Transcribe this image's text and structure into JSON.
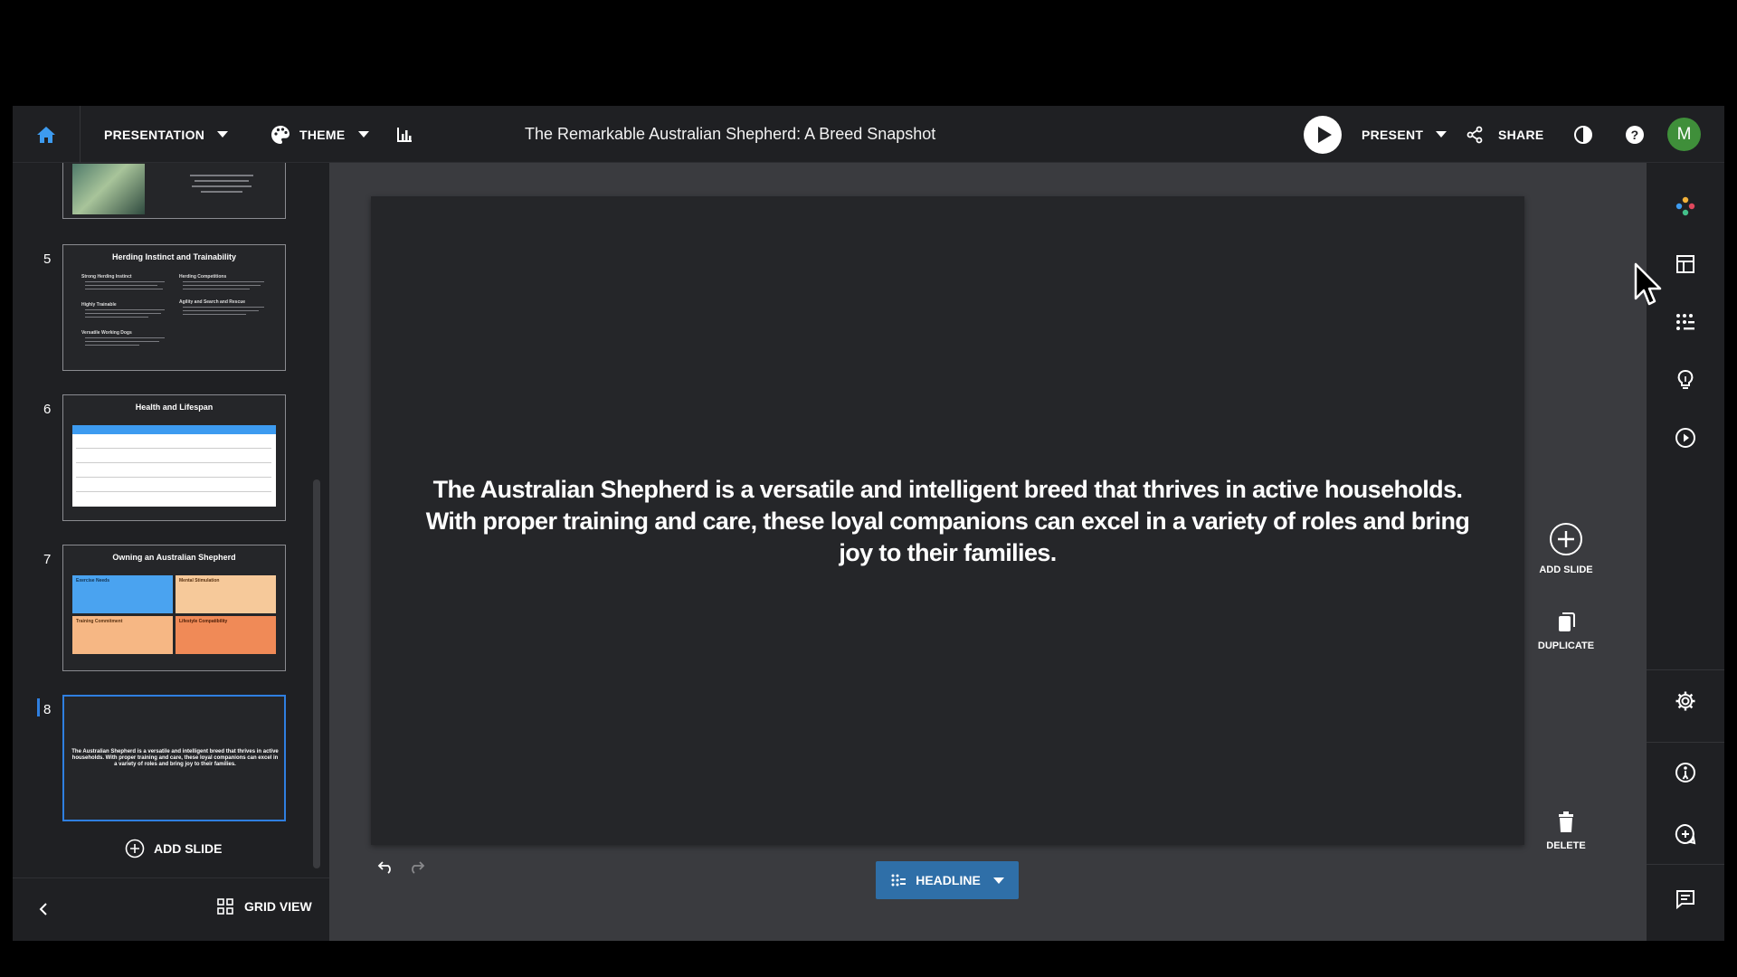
{
  "topbar": {
    "presentation_label": "PRESENTATION",
    "theme_label": "THEME",
    "doc_title": "The Remarkable Australian Shepherd: A Breed Snapshot",
    "present_label": "PRESENT",
    "share_label": "SHARE",
    "avatar_initial": "M"
  },
  "slides_panel": {
    "thumbnails": [
      {
        "number": "5",
        "title": "Herding Instinct and Trainability"
      },
      {
        "number": "6",
        "title": "Health and Lifespan"
      },
      {
        "number": "7",
        "title": "Owning an Australian Shepherd"
      },
      {
        "number": "8",
        "title": ""
      }
    ],
    "slide5_bullets": [
      "Strong Herding Instinct",
      "Highly Trainable",
      "Versatile Working Dogs",
      "Herding Competitions",
      "Agility and Search and Rescue"
    ],
    "slide7_boxes": [
      "Exercise Needs",
      "Mental Stimulation",
      "Training Commitment",
      "Lifestyle Compatibility"
    ],
    "slide8_text": "The Australian Shepherd is a versatile and intelligent breed that thrives in active households. With proper training and care, these loyal companions can excel in a variety of roles and bring joy to their families.",
    "add_slide_label": "ADD SLIDE",
    "grid_view_label": "GRID VIEW"
  },
  "canvas": {
    "slide_text": "The Australian Shepherd is a versatile and intelligent breed that thrives in active households. With proper training and care, these loyal companions can excel in a variety of roles and bring joy to their families.",
    "layout_label": "HEADLINE",
    "add_slide_label": "ADD SLIDE",
    "duplicate_label": "DUPLICATE",
    "delete_label": "DELETE"
  },
  "colors": {
    "accent_blue": "#2f7fe0",
    "headline_button": "#2f6fa8",
    "avatar_green": "#3f8f3a",
    "canvas_bg": "#3a3b3f",
    "slide_bg": "#252629"
  }
}
